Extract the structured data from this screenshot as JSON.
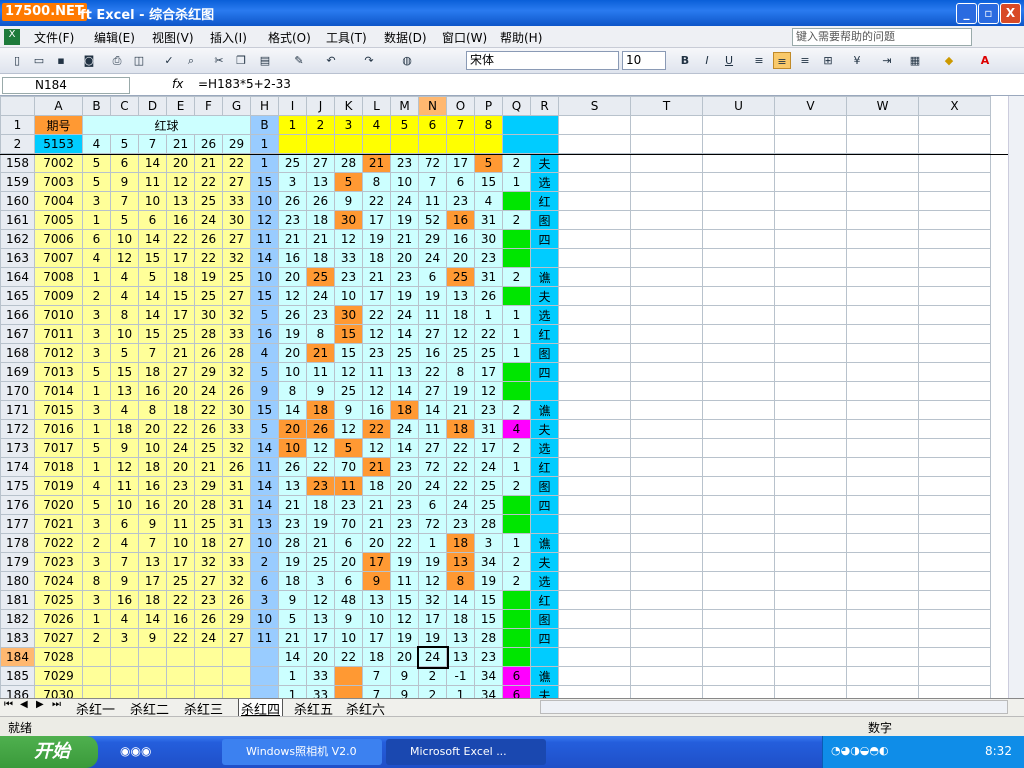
{
  "window": {
    "logo": "17500.NET",
    "title": "ft Excel - 综合杀红图",
    "min": "_",
    "restore": "▫",
    "close": "X"
  },
  "menu": [
    "文件(F)",
    "编辑(E)",
    "视图(V)",
    "插入(I)",
    "格式(O)",
    "工具(T)",
    "数据(D)",
    "窗口(W)",
    "帮助(H)"
  ],
  "help_placeholder": "键入需要帮助的问题",
  "font": {
    "name": "宋体",
    "size": "10"
  },
  "formula_bar": {
    "cell": "N184",
    "fx": "fx",
    "formula": "=H183*5+2-33"
  },
  "columns": [
    "A",
    "B",
    "C",
    "D",
    "E",
    "F",
    "G",
    "H",
    "I",
    "J",
    "K",
    "L",
    "M",
    "N",
    "O",
    "P",
    "Q",
    "R",
    "S",
    "T",
    "U",
    "V",
    "W",
    "X"
  ],
  "header_rows": [
    {
      "r": "1",
      "a": "期号",
      "red": "红球",
      "h": "B",
      "i_p": [
        "1",
        "2",
        "3",
        "4",
        "5",
        "6",
        "7",
        "8"
      ]
    },
    {
      "r": "2",
      "a": "5153",
      "bg": [
        "4",
        "5",
        "7",
        "21",
        "26",
        "29"
      ],
      "h": "1",
      "i_p": [
        "",
        "",
        "",
        "",
        "",
        "",
        "",
        ""
      ]
    }
  ],
  "rows": [
    [
      "158",
      "7002",
      "5",
      "6",
      "14",
      "20",
      "21",
      "22",
      "1",
      "25",
      "27",
      "28",
      "21",
      "23",
      "72",
      "17",
      "5",
      "2",
      "夫"
    ],
    [
      "159",
      "7003",
      "5",
      "9",
      "11",
      "12",
      "22",
      "27",
      "15",
      "3",
      "13",
      "5",
      "8",
      "10",
      "7",
      "6",
      "15",
      "1",
      "选"
    ],
    [
      "160",
      "7004",
      "3",
      "7",
      "10",
      "13",
      "25",
      "33",
      "10",
      "26",
      "26",
      "9",
      "22",
      "24",
      "11",
      "23",
      "4",
      "",
      "红"
    ],
    [
      "161",
      "7005",
      "1",
      "5",
      "6",
      "16",
      "24",
      "30",
      "12",
      "23",
      "18",
      "30",
      "17",
      "19",
      "52",
      "16",
      "31",
      "2",
      "图"
    ],
    [
      "162",
      "7006",
      "6",
      "10",
      "14",
      "22",
      "26",
      "27",
      "11",
      "21",
      "21",
      "12",
      "19",
      "21",
      "29",
      "16",
      "30",
      "",
      "四"
    ],
    [
      "163",
      "7007",
      "4",
      "12",
      "15",
      "17",
      "22",
      "32",
      "14",
      "16",
      "18",
      "33",
      "18",
      "20",
      "24",
      "20",
      "23",
      "",
      ""
    ],
    [
      "164",
      "7008",
      "1",
      "4",
      "5",
      "18",
      "19",
      "25",
      "10",
      "20",
      "25",
      "23",
      "21",
      "23",
      "6",
      "25",
      "31",
      "2",
      "谯"
    ],
    [
      "165",
      "7009",
      "2",
      "4",
      "14",
      "15",
      "25",
      "27",
      "15",
      "12",
      "24",
      "10",
      "17",
      "19",
      "19",
      "13",
      "26",
      "",
      "夫"
    ],
    [
      "166",
      "7010",
      "3",
      "8",
      "14",
      "17",
      "30",
      "32",
      "5",
      "26",
      "23",
      "30",
      "22",
      "24",
      "11",
      "18",
      "1",
      "1",
      "选"
    ],
    [
      "167",
      "7011",
      "3",
      "10",
      "15",
      "25",
      "28",
      "33",
      "16",
      "19",
      "8",
      "15",
      "12",
      "14",
      "27",
      "12",
      "22",
      "1",
      "红"
    ],
    [
      "168",
      "7012",
      "3",
      "5",
      "7",
      "21",
      "26",
      "28",
      "4",
      "20",
      "21",
      "15",
      "23",
      "25",
      "16",
      "25",
      "25",
      "1",
      "图"
    ],
    [
      "169",
      "7013",
      "5",
      "15",
      "18",
      "27",
      "29",
      "32",
      "5",
      "10",
      "11",
      "12",
      "11",
      "13",
      "22",
      "8",
      "17",
      "",
      "四"
    ],
    [
      "170",
      "7014",
      "1",
      "13",
      "16",
      "20",
      "24",
      "26",
      "9",
      "8",
      "9",
      "25",
      "12",
      "14",
      "27",
      "19",
      "12",
      "",
      ""
    ],
    [
      "171",
      "7015",
      "3",
      "4",
      "8",
      "18",
      "22",
      "30",
      "15",
      "14",
      "18",
      "9",
      "16",
      "18",
      "14",
      "21",
      "23",
      "2",
      "谯"
    ],
    [
      "172",
      "7016",
      "1",
      "18",
      "20",
      "22",
      "26",
      "33",
      "5",
      "20",
      "26",
      "12",
      "22",
      "24",
      "11",
      "18",
      "31",
      "4",
      "夫"
    ],
    [
      "173",
      "7017",
      "5",
      "9",
      "10",
      "24",
      "25",
      "32",
      "14",
      "10",
      "12",
      "5",
      "12",
      "14",
      "27",
      "22",
      "17",
      "2",
      "选"
    ],
    [
      "174",
      "7018",
      "1",
      "12",
      "18",
      "20",
      "21",
      "26",
      "11",
      "26",
      "22",
      "70",
      "21",
      "23",
      "72",
      "22",
      "24",
      "1",
      "红"
    ],
    [
      "175",
      "7019",
      "4",
      "11",
      "16",
      "23",
      "29",
      "31",
      "14",
      "13",
      "23",
      "11",
      "18",
      "20",
      "24",
      "22",
      "25",
      "2",
      "图"
    ],
    [
      "176",
      "7020",
      "5",
      "10",
      "16",
      "20",
      "28",
      "31",
      "14",
      "21",
      "18",
      "23",
      "21",
      "23",
      "6",
      "24",
      "25",
      "",
      "四"
    ],
    [
      "177",
      "7021",
      "3",
      "6",
      "9",
      "11",
      "25",
      "31",
      "13",
      "23",
      "19",
      "70",
      "21",
      "23",
      "72",
      "23",
      "28",
      "",
      ""
    ],
    [
      "178",
      "7022",
      "2",
      "4",
      "7",
      "10",
      "18",
      "27",
      "10",
      "28",
      "21",
      "6",
      "20",
      "22",
      "1",
      "18",
      "3",
      "1",
      "谯"
    ],
    [
      "179",
      "7023",
      "3",
      "7",
      "13",
      "17",
      "32",
      "33",
      "2",
      "19",
      "25",
      "20",
      "17",
      "19",
      "19",
      "13",
      "34",
      "2",
      "夫"
    ],
    [
      "180",
      "7024",
      "8",
      "9",
      "17",
      "25",
      "27",
      "32",
      "6",
      "18",
      "3",
      "6",
      "9",
      "11",
      "12",
      "8",
      "19",
      "2",
      "选"
    ],
    [
      "181",
      "7025",
      "3",
      "16",
      "18",
      "22",
      "23",
      "26",
      "3",
      "9",
      "12",
      "48",
      "13",
      "15",
      "32",
      "14",
      "15",
      "",
      "红"
    ],
    [
      "182",
      "7026",
      "1",
      "4",
      "14",
      "16",
      "26",
      "29",
      "10",
      "5",
      "13",
      "9",
      "10",
      "12",
      "17",
      "18",
      "15",
      "",
      "图"
    ],
    [
      "183",
      "7027",
      "2",
      "3",
      "9",
      "22",
      "24",
      "27",
      "11",
      "21",
      "17",
      "10",
      "17",
      "19",
      "19",
      "13",
      "28",
      "",
      "四"
    ],
    [
      "184",
      "7028",
      "",
      "",
      "",
      "",
      "",
      "",
      "",
      "14",
      "20",
      "22",
      "18",
      "20",
      "24",
      "13",
      "23",
      "",
      ""
    ],
    [
      "185",
      "7029",
      "",
      "",
      "",
      "",
      "",
      "",
      "",
      "1",
      "33",
      "",
      "7",
      "9",
      "2",
      "-1",
      "34",
      "6",
      "谯"
    ],
    [
      "186",
      "7030",
      "",
      "",
      "",
      "",
      "",
      "",
      "",
      "1",
      "33",
      "",
      "7",
      "9",
      "2",
      "1",
      "34",
      "6",
      "夫"
    ]
  ],
  "sheet_tabs": [
    "杀红一",
    "杀红二",
    "杀红三",
    "杀红四",
    "杀红五",
    "杀红六"
  ],
  "active_tab": "杀红四",
  "status": {
    "left": "就绪",
    "num": "数字"
  },
  "taskbar": {
    "start": "开始",
    "tasks": [
      "Windows照相机 V2.0",
      "Microsoft Excel ..."
    ],
    "clock": "8:32"
  },
  "colors": {
    "cyan": "#00ccff",
    "yellow": "#ffff00",
    "pale_yellow": "#ffff99",
    "pale_blue": "#ccffff",
    "light_blue": "#99ccff",
    "orange": "#ff9933",
    "green": "#00e600",
    "magenta": "#ff00ff"
  }
}
